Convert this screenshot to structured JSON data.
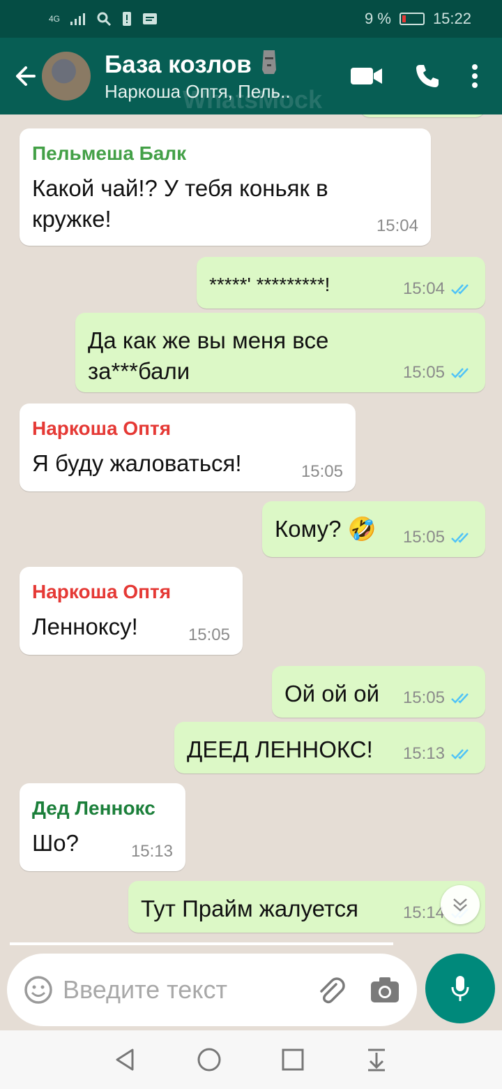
{
  "status_bar": {
    "network": "4G",
    "battery": "9 %",
    "time": "15:22"
  },
  "header": {
    "title": "База козлов",
    "subtitle": "Наркоша Оптя, Пель..",
    "watermark": "WhatsMock"
  },
  "messages": [
    {
      "dir": "in",
      "sender": "Пельмеша Балк",
      "sender_color": "#43a047",
      "text": "Какой чай!? У тебя коньяк в\nкружке!",
      "time": "15:04"
    },
    {
      "dir": "out",
      "text": "*****' *********!",
      "time": "15:04"
    },
    {
      "dir": "out",
      "text": "Да как же вы меня все\nза***бали",
      "time": "15:05"
    },
    {
      "dir": "in",
      "sender": "Наркоша Оптя",
      "sender_color": "#e53935",
      "text": "Я буду жаловаться!",
      "time": "15:05"
    },
    {
      "dir": "out",
      "text": "Кому? 🤣",
      "time": "15:05"
    },
    {
      "dir": "in",
      "sender": "Наркоша Оптя",
      "sender_color": "#e53935",
      "text": "Ленноксу!",
      "time": "15:05"
    },
    {
      "dir": "out",
      "text": "Ой ой ой",
      "time": "15:05"
    },
    {
      "dir": "out",
      "text": "ДЕЕД ЛЕННОКС!",
      "time": "15:13"
    },
    {
      "dir": "in",
      "sender": "Дед Леннокс",
      "sender_color": "#1b7f3a",
      "text": "Шо?",
      "time": "15:13"
    },
    {
      "dir": "out",
      "text": "Тут Прайм жалуется",
      "time": "15:14"
    }
  ],
  "composer": {
    "placeholder": "Введите текст"
  },
  "colors": {
    "header": "#075e54",
    "status": "#054d44",
    "outgoing": "#dcf8c6",
    "read_ticks": "#4fc3f7",
    "mic": "#00897b"
  }
}
